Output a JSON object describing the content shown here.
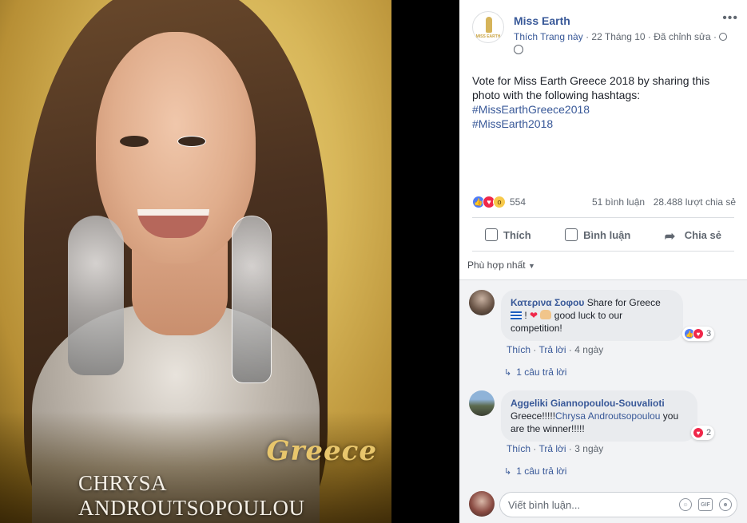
{
  "photo": {
    "country_text": "Greece",
    "contestant_name": "CHRYSA ANDROUTSOPOULOU"
  },
  "post": {
    "page_name": "Miss Earth",
    "like_page": "Thích Trang này",
    "date": "22 Tháng 10",
    "edited": "Đã chỉnh sửa",
    "text": "Vote for Miss Earth Greece 2018 by sharing this photo with the following hashtags:",
    "hashtags": [
      "#MissEarthGreece2018",
      "#MissEarth2018"
    ],
    "logo_text": "MISS EARTH"
  },
  "stats": {
    "reaction_count": "554",
    "comments": "51 bình luận",
    "shares": "28.488 lượt chia sẻ"
  },
  "actions": {
    "like": "Thích",
    "comment": "Bình luận",
    "share": "Chia sẻ"
  },
  "sort_label": "Phù hợp nhất",
  "comments": [
    {
      "author": "Κατερινα Σοφου",
      "text_part1": "Share for Greece",
      "text_part2": "good luck to our competition!",
      "reaction_count": "3",
      "like": "Thích",
      "reply": "Trả lời",
      "time": "4 ngày",
      "replies": "1 câu trả lời"
    },
    {
      "author": "Aggeliki Giannopoulou-Souvalioti",
      "text_part1": "Greece!!!!!",
      "mention": "Chrysa Androutsopoulou",
      "text_part2": "you are the winner!!!!!",
      "reaction_count": "2",
      "like": "Thích",
      "reply": "Trả lời",
      "time": "3 ngày",
      "replies": "1 câu trả lời"
    }
  ],
  "composer": {
    "placeholder": "Viết bình luận...",
    "gif_label": "GIF"
  },
  "colors": {
    "link": "#385898",
    "like_blue": "#4f7cf5",
    "love_red": "#f0284a"
  }
}
